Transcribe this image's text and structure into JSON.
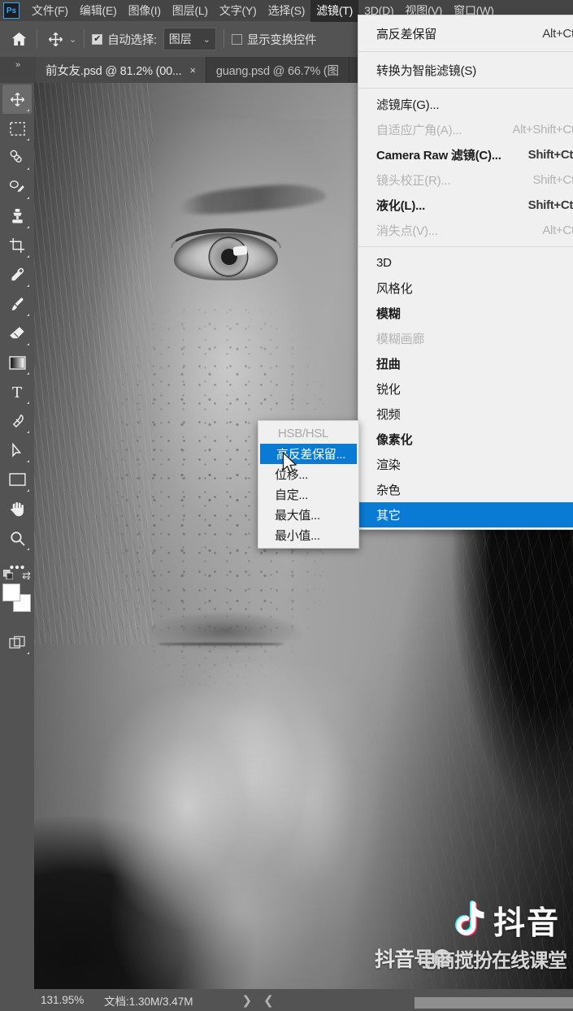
{
  "app": {
    "name": "Adobe Photoshop",
    "logo_text": "Ps"
  },
  "menubar": {
    "items": [
      {
        "label": "文件(F)",
        "active": false
      },
      {
        "label": "编辑(E)",
        "active": false
      },
      {
        "label": "图像(I)",
        "active": false
      },
      {
        "label": "图层(L)",
        "active": false
      },
      {
        "label": "文字(Y)",
        "active": false
      },
      {
        "label": "选择(S)",
        "active": false
      },
      {
        "label": "滤镜(T)",
        "active": true
      },
      {
        "label": "3D(D)",
        "active": false
      },
      {
        "label": "视图(V)",
        "active": false
      },
      {
        "label": "窗口(W)",
        "active": false
      }
    ]
  },
  "options_bar": {
    "home_icon": "home-icon",
    "move_tool_icon": "move-tool-icon",
    "auto_select_checked": true,
    "auto_select_label": "自动选择:",
    "auto_select_value": "图层",
    "show_transform_checked": false,
    "show_transform_label": "显示变换控件"
  },
  "tabs": {
    "collapse_icon": "expand-panels-icon",
    "items": [
      {
        "title": "前女友.psd @ 81.2% (00...",
        "close": "×",
        "active": true
      },
      {
        "title": "guang.psd @ 66.7% (图",
        "close": "",
        "active": false
      }
    ]
  },
  "toolbar": {
    "tools": [
      {
        "name": "move-tool",
        "selected": true
      },
      {
        "name": "rectangular-marquee-tool",
        "selected": false
      },
      {
        "name": "healing-brush-tool",
        "selected": false
      },
      {
        "name": "lasso-brush-tool",
        "selected": false
      },
      {
        "name": "clone-stamp-tool",
        "selected": false
      },
      {
        "name": "crop-tool",
        "selected": false
      },
      {
        "name": "eyedropper-tool",
        "selected": false
      },
      {
        "name": "brush-tool",
        "selected": false
      },
      {
        "name": "eraser-tool",
        "selected": false
      },
      {
        "name": "gradient-tool",
        "selected": false
      },
      {
        "name": "type-tool",
        "selected": false
      },
      {
        "name": "pen-tool",
        "selected": false
      },
      {
        "name": "path-selection-tool",
        "selected": false
      },
      {
        "name": "rectangle-tool",
        "selected": false
      },
      {
        "name": "hand-tool",
        "selected": false
      },
      {
        "name": "zoom-tool",
        "selected": false
      },
      {
        "name": "edit-toolbar-tool",
        "selected": false
      }
    ],
    "foreground_color": "#ffffff",
    "background_color": "#ffffff",
    "quickmask_icon": "quick-mask-icon"
  },
  "filter_menu": {
    "groups": [
      {
        "rows": [
          {
            "label": "高反差保留",
            "key": "Alt+Ctrl+",
            "bold": false,
            "disabled": false,
            "highlighted": false,
            "submenu": false
          }
        ]
      },
      {
        "rows": [
          {
            "label": "转换为智能滤镜(S)",
            "key": "",
            "bold": false,
            "disabled": false,
            "highlighted": false,
            "submenu": false
          }
        ]
      },
      {
        "rows": [
          {
            "label": "滤镜库(G)...",
            "key": "",
            "bold": false,
            "disabled": false,
            "highlighted": false,
            "submenu": false
          },
          {
            "label": "自适应广角(A)...",
            "key": "Alt+Shift+Ctrl+",
            "bold": false,
            "disabled": true,
            "highlighted": false,
            "submenu": false
          },
          {
            "label": "Camera Raw 滤镜(C)...",
            "key": "Shift+Ctrl+",
            "bold": true,
            "disabled": false,
            "highlighted": false,
            "submenu": false
          },
          {
            "label": "镜头校正(R)...",
            "key": "Shift+Ctrl+",
            "bold": false,
            "disabled": true,
            "highlighted": false,
            "submenu": false
          },
          {
            "label": "液化(L)...",
            "key": "Shift+Ctrl+",
            "bold": true,
            "disabled": false,
            "highlighted": false,
            "submenu": false
          },
          {
            "label": "消失点(V)...",
            "key": "Alt+Ctrl+",
            "bold": false,
            "disabled": true,
            "highlighted": false,
            "submenu": false
          }
        ]
      },
      {
        "rows": [
          {
            "label": "3D",
            "key": "",
            "bold": false,
            "disabled": false,
            "highlighted": false,
            "submenu": true
          },
          {
            "label": "风格化",
            "key": "",
            "bold": false,
            "disabled": false,
            "highlighted": false,
            "submenu": true
          },
          {
            "label": "模糊",
            "key": "",
            "bold": true,
            "disabled": false,
            "highlighted": false,
            "submenu": true
          },
          {
            "label": "模糊画廊",
            "key": "",
            "bold": false,
            "disabled": true,
            "highlighted": false,
            "submenu": true
          },
          {
            "label": "扭曲",
            "key": "",
            "bold": true,
            "disabled": false,
            "highlighted": false,
            "submenu": true
          },
          {
            "label": "锐化",
            "key": "",
            "bold": false,
            "disabled": false,
            "highlighted": false,
            "submenu": true
          },
          {
            "label": "视频",
            "key": "",
            "bold": false,
            "disabled": false,
            "highlighted": false,
            "submenu": true
          },
          {
            "label": "像素化",
            "key": "",
            "bold": true,
            "disabled": false,
            "highlighted": false,
            "submenu": true
          },
          {
            "label": "渲染",
            "key": "",
            "bold": false,
            "disabled": false,
            "highlighted": false,
            "submenu": true
          },
          {
            "label": "杂色",
            "key": "",
            "bold": false,
            "disabled": false,
            "highlighted": false,
            "submenu": true
          },
          {
            "label": "其它",
            "key": "",
            "bold": false,
            "disabled": false,
            "highlighted": true,
            "submenu": true
          }
        ]
      }
    ]
  },
  "submenu": {
    "items": [
      {
        "label": "HSB/HSL",
        "disabled": true,
        "highlighted": false
      },
      {
        "label": "高反差保留...",
        "disabled": false,
        "highlighted": true
      },
      {
        "label": "位移...",
        "disabled": false,
        "highlighted": false
      },
      {
        "label": "自定...",
        "disabled": false,
        "highlighted": false
      },
      {
        "label": "最大值...",
        "disabled": false,
        "highlighted": false
      },
      {
        "label": "最小值...",
        "disabled": false,
        "highlighted": false
      }
    ]
  },
  "status_bar": {
    "zoom": "131.95%",
    "doc_info": "文档:1.30M/3.47M",
    "next_arrow": "❯",
    "prev_arrow": "❮"
  },
  "watermarks": {
    "douyin_label": "抖音",
    "douyin_icon": "douyin-note-icon",
    "bottom_left_text": "抖音号",
    "bottom_right_text": "电商搅扮在线课堂",
    "wechat_icon": "wechat-icon"
  },
  "colors": {
    "menu_highlight": "#0a7bd4",
    "panel_bg": "#535353",
    "menubar_bg": "#454545",
    "menu_popup_bg": "#f0f0f0",
    "canvas_bg": "#1a1a1a",
    "accent_blue": "#31a8ff"
  }
}
